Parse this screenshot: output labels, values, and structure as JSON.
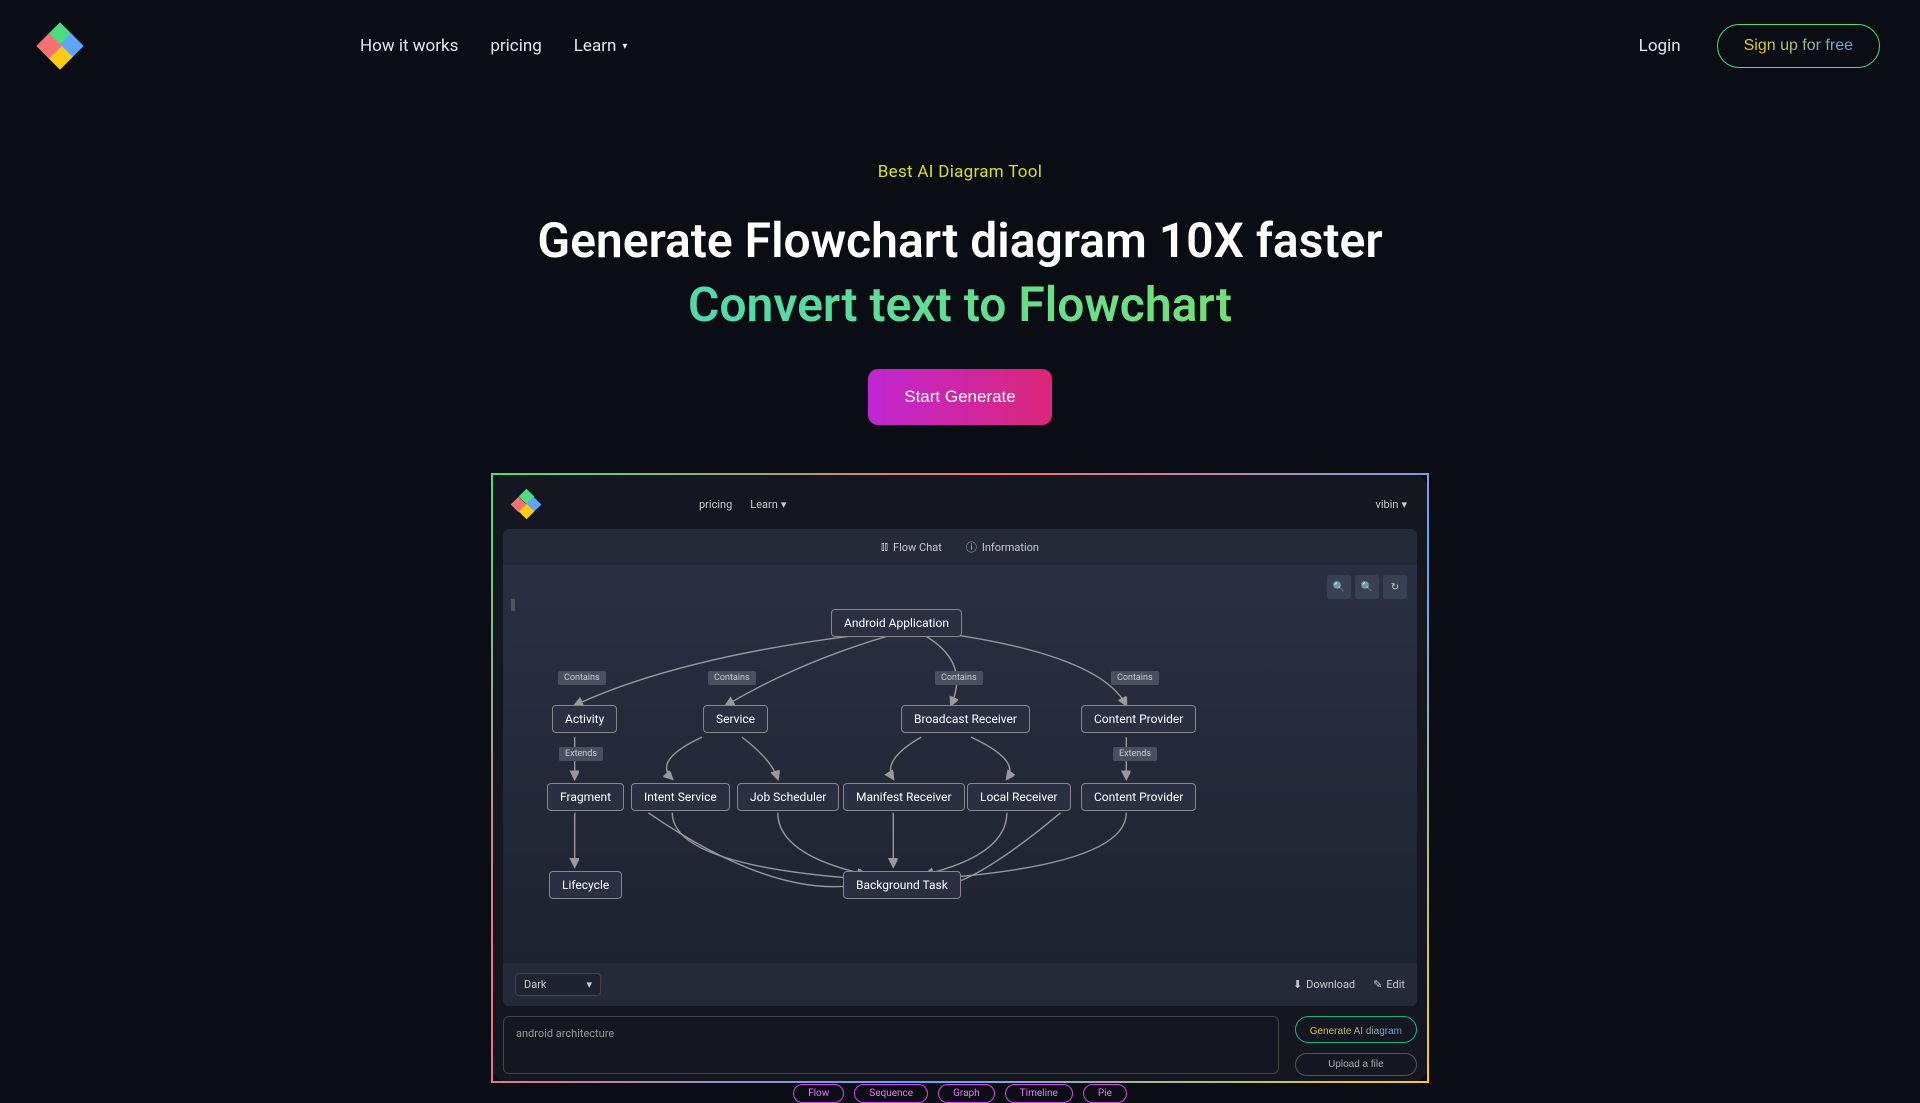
{
  "nav": {
    "links": [
      "How it works",
      "pricing",
      "Learn"
    ],
    "login": "Login",
    "signup": "Sign up for free"
  },
  "hero": {
    "badge": "Best AI Diagram Tool",
    "headline": "Generate Flowchart diagram 10X faster",
    "subheadline": "Convert text to Flowchart",
    "cta": "Start Generate"
  },
  "app": {
    "nav": [
      "pricing",
      "Learn"
    ],
    "user": "vibin",
    "tabs": [
      "Flow Chat",
      "Information"
    ],
    "theme": "Dark",
    "footer": {
      "download": "Download",
      "edit": "Edit"
    },
    "prompt": "android architecture",
    "generate": "Generate AI diagram",
    "upload": "Upload a file",
    "pills": [
      "Flow",
      "Sequence",
      "Graph",
      "Timeline",
      "Pie"
    ]
  },
  "flow": {
    "nodes": {
      "root": "Android Application",
      "activity": "Activity",
      "service": "Service",
      "broadcast": "Broadcast Receiver",
      "content1": "Content Provider",
      "fragment": "Fragment",
      "intentsvc": "Intent Service",
      "jobsched": "Job Scheduler",
      "manifest": "Manifest Receiver",
      "localrecv": "Local Receiver",
      "content2": "Content Provider",
      "lifecycle": "Lifecycle",
      "bgtask": "Background Task"
    },
    "labels": {
      "contains": "Contains",
      "extends": "Extends"
    }
  }
}
